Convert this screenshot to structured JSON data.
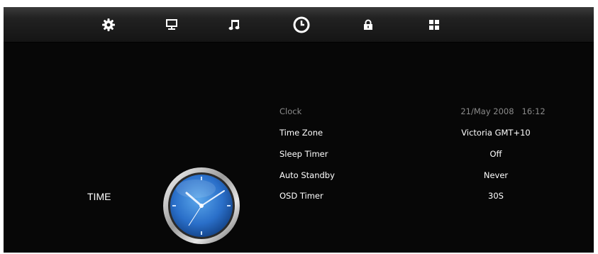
{
  "nav": {
    "icons": [
      "gear-icon",
      "monitor-icon",
      "music-note-icon",
      "clock-icon",
      "lock-icon",
      "grid-icon"
    ],
    "selected": "clock-icon"
  },
  "panel": {
    "title": "TIME",
    "rows": [
      {
        "label": "Clock",
        "value": "21/May 2008   16:12",
        "dimmed": true
      },
      {
        "label": "Time Zone",
        "value": "Victoria GMT+10",
        "dimmed": false
      },
      {
        "label": "Sleep Timer",
        "value": "Off",
        "dimmed": false
      },
      {
        "label": "Auto Standby",
        "value": "Never",
        "dimmed": false
      },
      {
        "label": "OSD Timer",
        "value": "30S",
        "dimmed": false
      }
    ]
  },
  "colors": {
    "background": "#070707",
    "text": "#ffffff",
    "dim_text": "#8a8a8a",
    "clock_face": "#2a6fc9"
  }
}
